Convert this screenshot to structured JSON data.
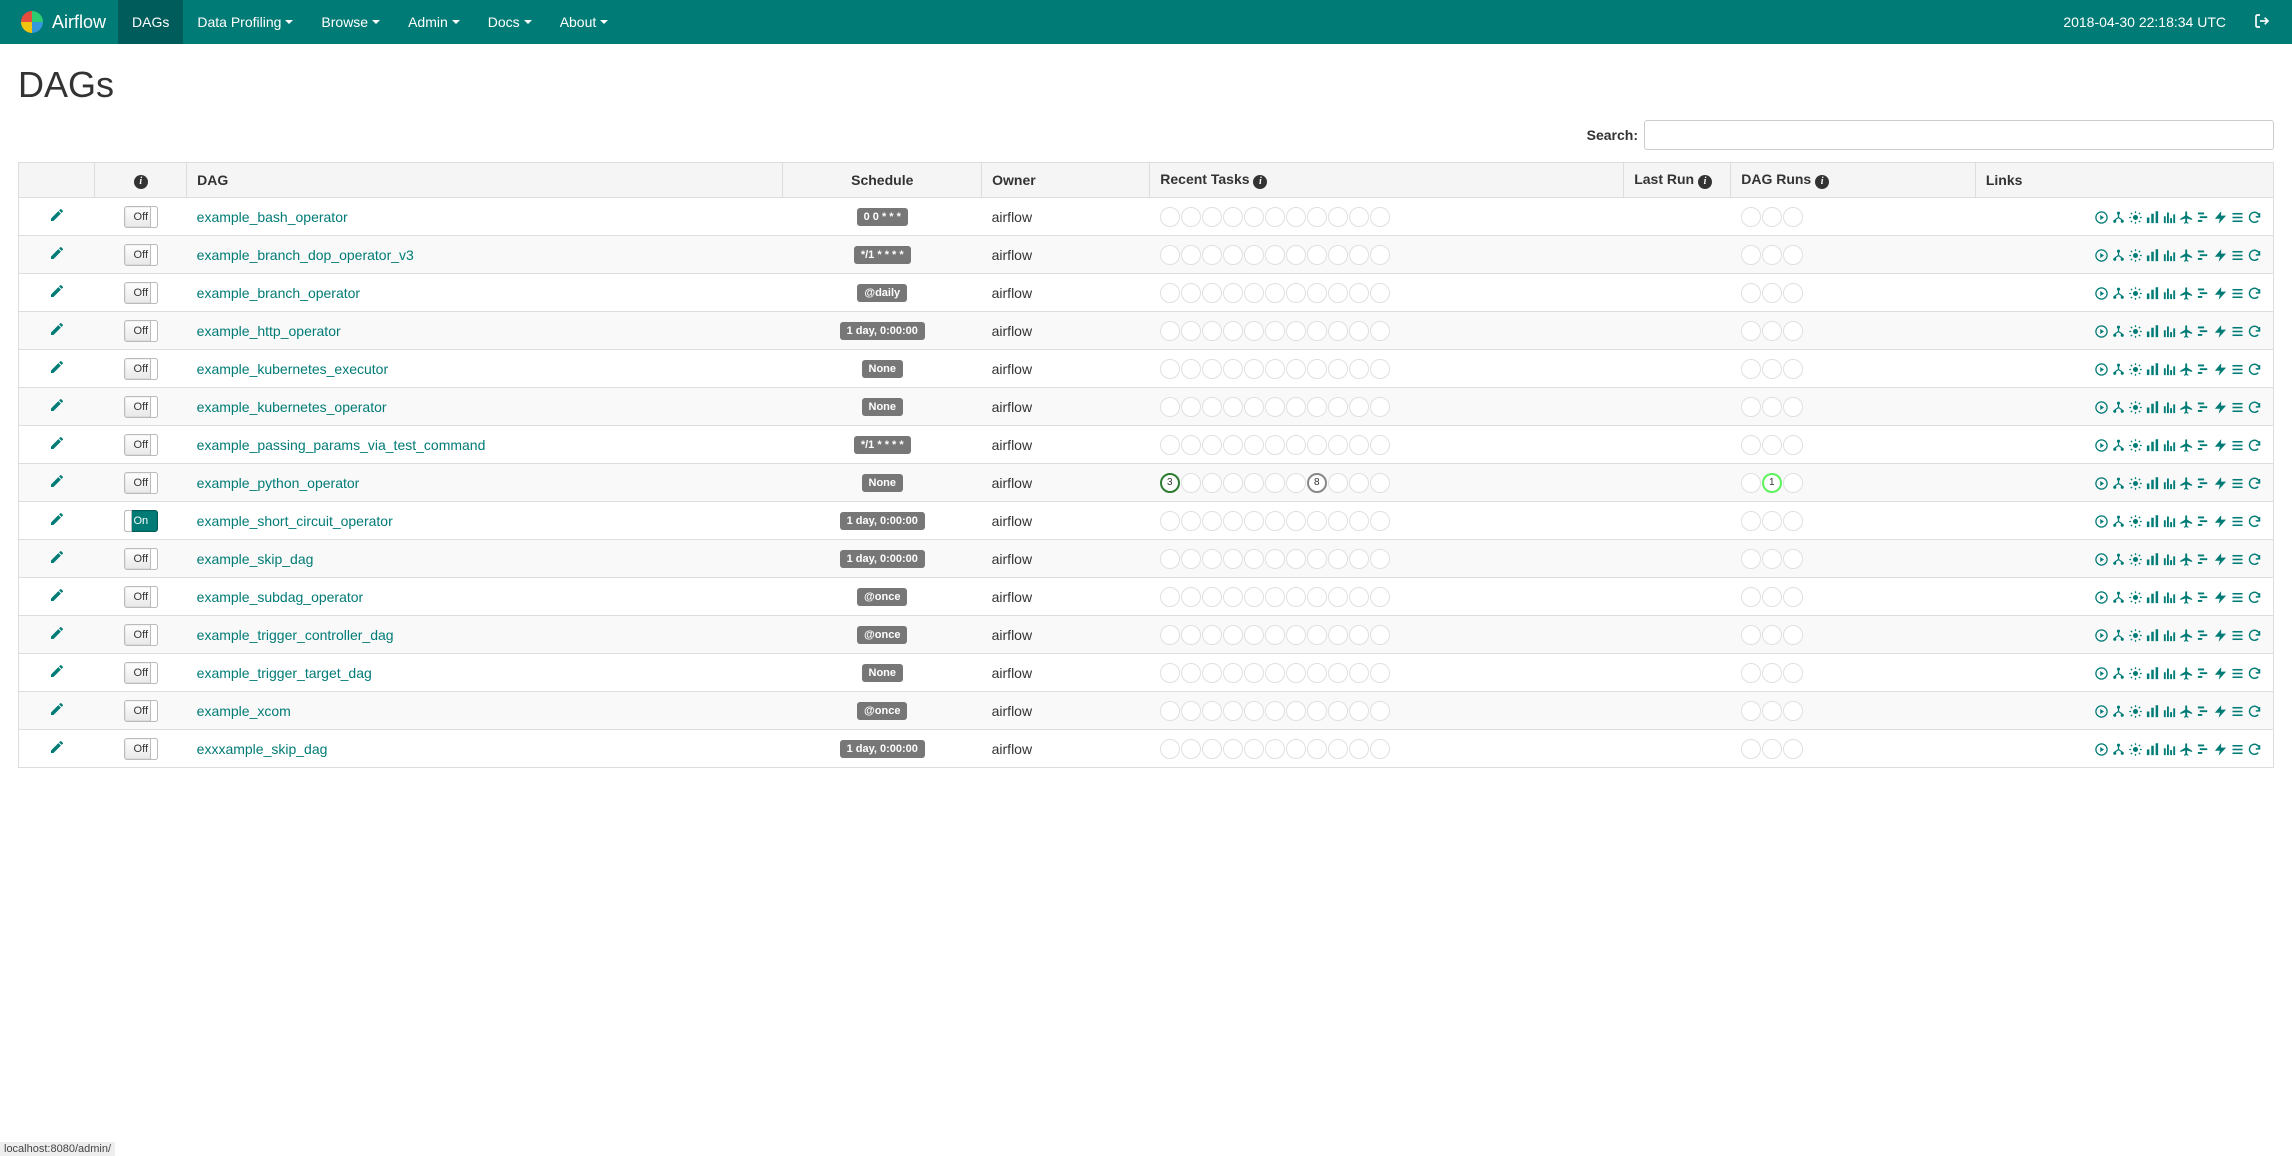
{
  "brand": "Airflow",
  "nav": {
    "items": [
      {
        "label": "DAGs",
        "active": true,
        "dropdown": false
      },
      {
        "label": "Data Profiling",
        "active": false,
        "dropdown": true
      },
      {
        "label": "Browse",
        "active": false,
        "dropdown": true
      },
      {
        "label": "Admin",
        "active": false,
        "dropdown": true
      },
      {
        "label": "Docs",
        "active": false,
        "dropdown": true
      },
      {
        "label": "About",
        "active": false,
        "dropdown": true
      }
    ],
    "clock": "2018-04-30 22:18:34 UTC"
  },
  "page_title": "DAGs",
  "search_label": "Search:",
  "table": {
    "headers": {
      "dag": "DAG",
      "schedule": "Schedule",
      "owner": "Owner",
      "recent_tasks": "Recent Tasks",
      "last_run": "Last Run",
      "dag_runs": "DAG Runs",
      "links": "Links"
    },
    "toggle_labels": {
      "on": "On",
      "off": "Off"
    },
    "rows": [
      {
        "dag": "example_bash_operator",
        "schedule": "0 0 * * *",
        "owner": "airflow",
        "on": false,
        "recent": [],
        "runs": []
      },
      {
        "dag": "example_branch_dop_operator_v3",
        "schedule": "*/1 * * * *",
        "owner": "airflow",
        "on": false,
        "recent": [],
        "runs": []
      },
      {
        "dag": "example_branch_operator",
        "schedule": "@daily",
        "owner": "airflow",
        "on": false,
        "recent": [],
        "runs": []
      },
      {
        "dag": "example_http_operator",
        "schedule": "1 day, 0:00:00",
        "owner": "airflow",
        "on": false,
        "recent": [],
        "runs": []
      },
      {
        "dag": "example_kubernetes_executor",
        "schedule": "None",
        "owner": "airflow",
        "on": false,
        "recent": [],
        "runs": []
      },
      {
        "dag": "example_kubernetes_operator",
        "schedule": "None",
        "owner": "airflow",
        "on": false,
        "recent": [],
        "runs": []
      },
      {
        "dag": "example_passing_params_via_test_command",
        "schedule": "*/1 * * * *",
        "owner": "airflow",
        "on": false,
        "recent": [],
        "runs": []
      },
      {
        "dag": "example_python_operator",
        "schedule": "None",
        "owner": "airflow",
        "on": false,
        "recent": [
          {
            "count": "3",
            "style": "success"
          },
          {
            "style": "blank"
          },
          {
            "style": "blank"
          },
          {
            "style": "blank"
          },
          {
            "style": "blank"
          },
          {
            "style": "blank"
          },
          {
            "style": "blank"
          },
          {
            "count": "8",
            "style": "gray-border"
          },
          {
            "style": "blank"
          },
          {
            "style": "blank"
          },
          {
            "style": "blank"
          }
        ],
        "runs": [
          {
            "style": "blank"
          },
          {
            "count": "1",
            "style": "bright-green"
          },
          {
            "style": "blank"
          }
        ]
      },
      {
        "dag": "example_short_circuit_operator",
        "schedule": "1 day, 0:00:00",
        "owner": "airflow",
        "on": true,
        "recent": [],
        "runs": []
      },
      {
        "dag": "example_skip_dag",
        "schedule": "1 day, 0:00:00",
        "owner": "airflow",
        "on": false,
        "recent": [],
        "runs": []
      },
      {
        "dag": "example_subdag_operator",
        "schedule": "@once",
        "owner": "airflow",
        "on": false,
        "recent": [],
        "runs": []
      },
      {
        "dag": "example_trigger_controller_dag",
        "schedule": "@once",
        "owner": "airflow",
        "on": false,
        "recent": [],
        "runs": []
      },
      {
        "dag": "example_trigger_target_dag",
        "schedule": "None",
        "owner": "airflow",
        "on": false,
        "recent": [],
        "runs": []
      },
      {
        "dag": "example_xcom",
        "schedule": "@once",
        "owner": "airflow",
        "on": false,
        "recent": [],
        "runs": []
      },
      {
        "dag": "exxxample_skip_dag",
        "schedule": "1 day, 0:00:00",
        "owner": "airflow",
        "on": false,
        "recent": [],
        "runs": []
      }
    ]
  },
  "status_bar": "localhost:8080/admin/"
}
